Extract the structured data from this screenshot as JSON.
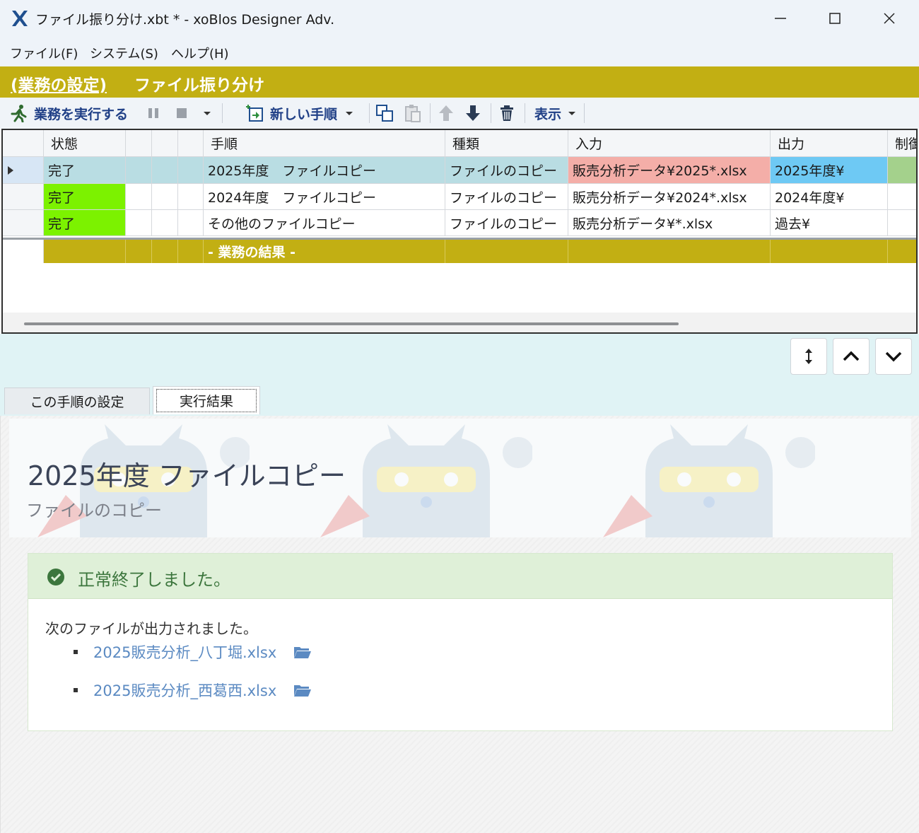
{
  "window": {
    "title": "ファイル振り分け.xbt *  - xoBlos Designer Adv."
  },
  "menu": {
    "items": [
      "ファイル(F)",
      "システム(S)",
      "ヘルプ(H)"
    ]
  },
  "header": {
    "link": "(業務の設定)",
    "title": "ファイル振り分け"
  },
  "toolbar": {
    "run_label": "業務を実行する",
    "new_step_label": "新しい手順",
    "view_label": "表示"
  },
  "grid": {
    "columns": [
      "状態",
      "",
      "",
      "手順",
      "種類",
      "入力",
      "出力",
      "制御"
    ],
    "rows": [
      {
        "status": "完了",
        "step": "2025年度　ファイルコピー",
        "kind": "ファイルのコピー",
        "input": "販売分析データ¥2025*.xlsx",
        "output": "2025年度¥"
      },
      {
        "status": "完了",
        "step": "2024年度　ファイルコピー",
        "kind": "ファイルのコピー",
        "input": "販売分析データ¥2024*.xlsx",
        "output": "2024年度¥"
      },
      {
        "status": "完了",
        "step": "その他のファイルコピー",
        "kind": "ファイルのコピー",
        "input": "販売分析データ¥*.xlsx",
        "output": "過去¥"
      }
    ],
    "result_row_label": "- 業務の結果 -"
  },
  "tabs": {
    "settings": "この手順の設定",
    "results": "実行結果"
  },
  "result": {
    "title": "2025年度  ファイルコピー",
    "subtitle": "ファイルのコピー",
    "status_message": "正常終了しました。",
    "files_message": "次のファイルが出力されました。",
    "files": [
      "2025販売分析_八丁堀.xlsx",
      "2025販売分析_西葛西.xlsx"
    ]
  },
  "colors": {
    "accent": "#c2af13",
    "status_done": "#7cf200",
    "input_highlight": "#f4aea8",
    "output_highlight": "#6ec9f4",
    "success_bg": "#dff0d8",
    "success_text": "#3c763d",
    "link": "#5b8ac2"
  }
}
